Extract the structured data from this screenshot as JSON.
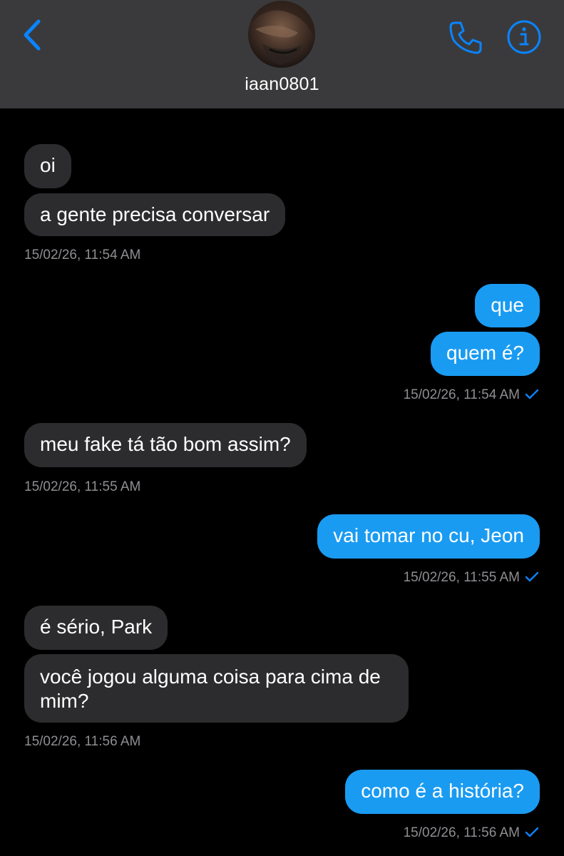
{
  "header": {
    "contact_name": "iaan0801",
    "accent_color": "#0a84ff",
    "icons": {
      "back": "chevron-left-icon",
      "call": "phone-icon",
      "info": "info-circle-icon"
    }
  },
  "messages": [
    {
      "direction": "incoming",
      "text": "oi"
    },
    {
      "direction": "incoming",
      "text": "a gente precisa conversar"
    },
    {
      "type": "timestamp",
      "text": "15/02/26, 11:54 AM"
    },
    {
      "direction": "outgoing",
      "text": "que"
    },
    {
      "direction": "outgoing",
      "text": "quem é?"
    },
    {
      "type": "timestamp",
      "text": "15/02/26, 11:54 AM",
      "read": true
    },
    {
      "direction": "incoming",
      "text": "meu fake tá tão bom assim?"
    },
    {
      "type": "timestamp",
      "text": "15/02/26, 11:55 AM"
    },
    {
      "direction": "outgoing",
      "text": "vai tomar no cu, Jeon"
    },
    {
      "type": "timestamp",
      "text": "15/02/26, 11:55 AM",
      "read": true
    },
    {
      "direction": "incoming",
      "text": "é sério, Park"
    },
    {
      "direction": "incoming",
      "text": "você jogou alguma coisa para cima de mim?"
    },
    {
      "type": "timestamp",
      "text": "15/02/26, 11:56 AM"
    },
    {
      "direction": "outgoing",
      "text": "como é a história?"
    },
    {
      "type": "timestamp",
      "text": "15/02/26, 11:56 AM",
      "read": true
    }
  ],
  "colors": {
    "incoming_bubble": "#2c2c2e",
    "outgoing_bubble": "#1a9bf2",
    "timestamp": "#8e8e93",
    "read_check": "#0a84ff",
    "header_bg": "#3a3a3c",
    "background": "#000000"
  }
}
